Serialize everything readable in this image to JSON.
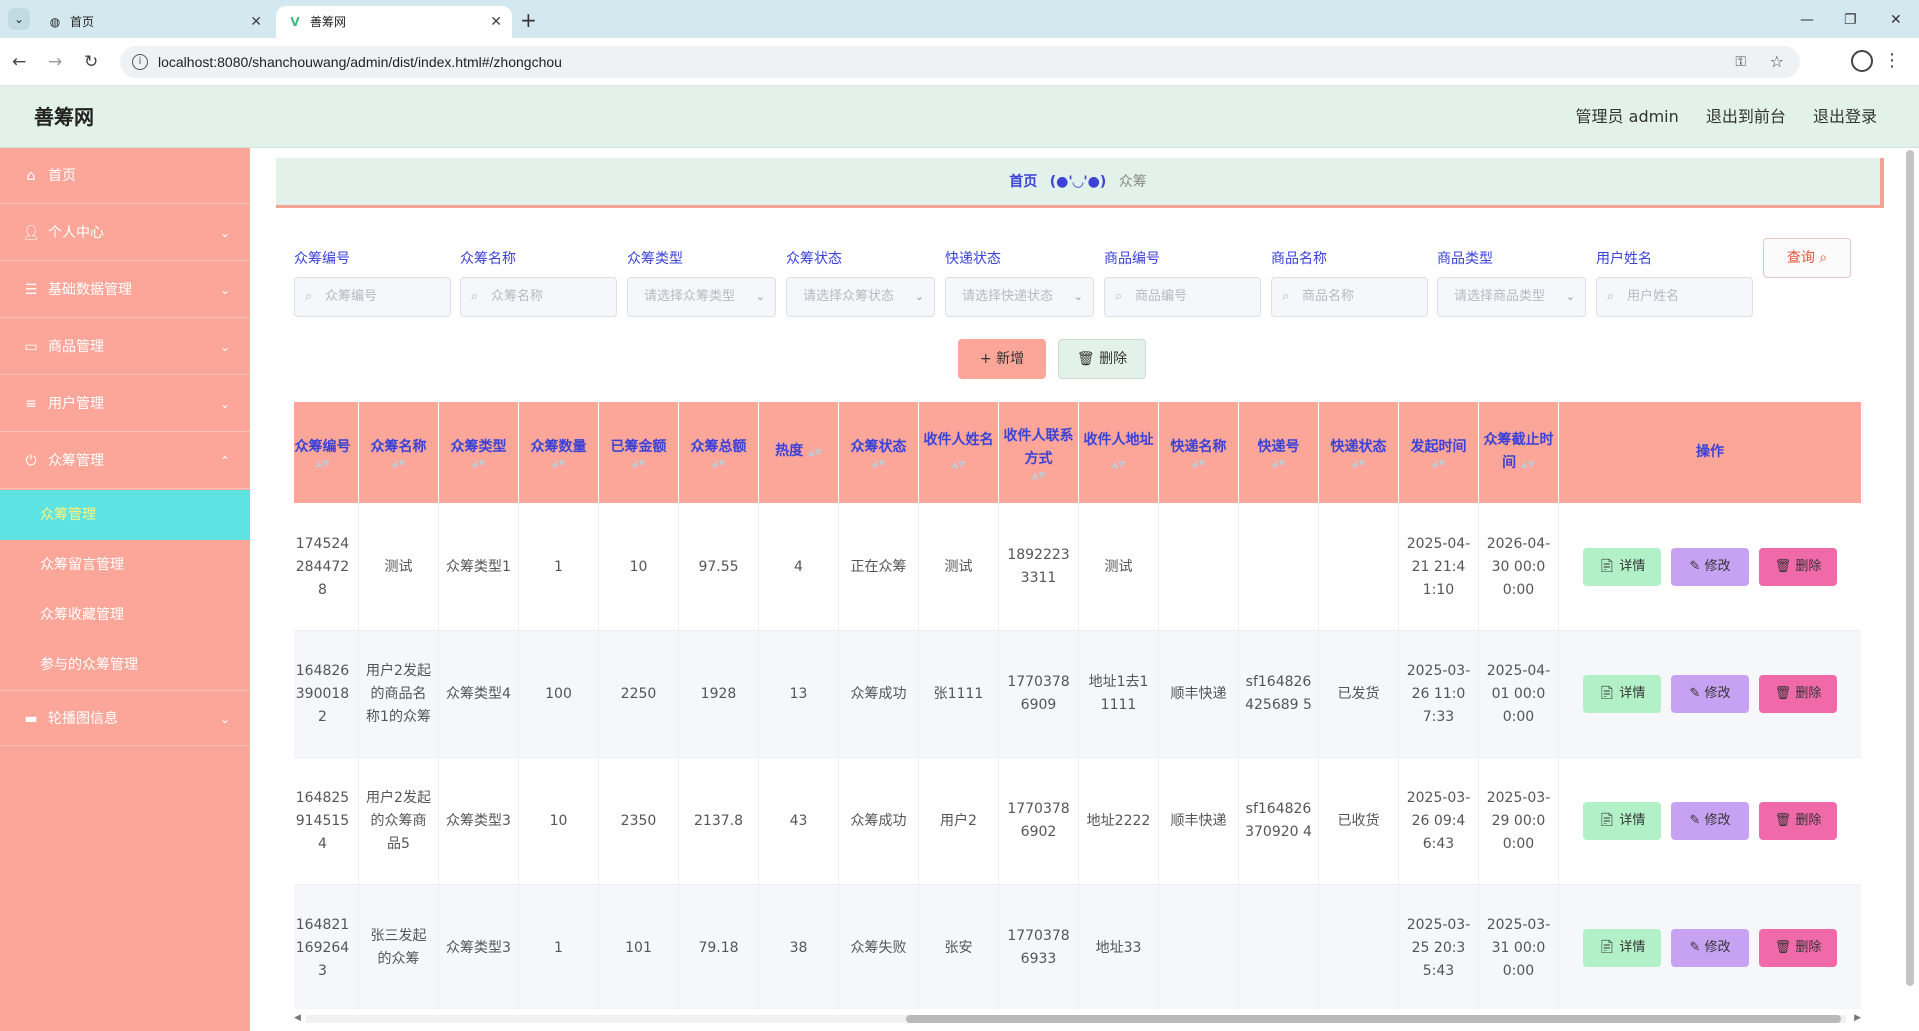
{
  "browser": {
    "tabs": [
      {
        "title": "首页",
        "active": false
      },
      {
        "title": "善筹网",
        "active": true
      }
    ],
    "url": "localhost:8080/shanchouwang/admin/dist/index.html#/zhongchou"
  },
  "header": {
    "brand": "善筹网",
    "admin": "管理员 admin",
    "to_front": "退出到前台",
    "logout": "退出登录"
  },
  "sidebar": {
    "items": [
      {
        "label": "首页",
        "icon": "home-icon"
      },
      {
        "label": "个人中心",
        "icon": "user-icon"
      },
      {
        "label": "基础数据管理",
        "icon": "sliders-icon"
      },
      {
        "label": "商品管理",
        "icon": "card-icon"
      },
      {
        "label": "用户管理",
        "icon": "list-icon"
      },
      {
        "label": "众筹管理",
        "icon": "power-icon"
      },
      {
        "label": "轮播图信息",
        "icon": "monitor-icon"
      }
    ],
    "sub_items": [
      {
        "label": "众筹管理",
        "active": true
      },
      {
        "label": "众筹留言管理",
        "active": false
      },
      {
        "label": "众筹收藏管理",
        "active": false
      },
      {
        "label": "参与的众筹管理",
        "active": false
      }
    ]
  },
  "breadcrumb": {
    "home": "首页",
    "separator": "(●'◡'●)",
    "current": "众筹"
  },
  "filters": [
    {
      "label": "众筹编号",
      "placeholder": "众筹编号",
      "kind": "input"
    },
    {
      "label": "众筹名称",
      "placeholder": "众筹名称",
      "kind": "input"
    },
    {
      "label": "众筹类型",
      "placeholder": "请选择众筹类型",
      "kind": "select"
    },
    {
      "label": "众筹状态",
      "placeholder": "请选择众筹状态",
      "kind": "select"
    },
    {
      "label": "快递状态",
      "placeholder": "请选择快递状态",
      "kind": "select"
    },
    {
      "label": "商品编号",
      "placeholder": "商品编号",
      "kind": "input"
    },
    {
      "label": "商品名称",
      "placeholder": "商品名称",
      "kind": "input"
    },
    {
      "label": "商品类型",
      "placeholder": "请选择商品类型",
      "kind": "select"
    },
    {
      "label": "用户姓名",
      "placeholder": "用户姓名",
      "kind": "input"
    }
  ],
  "actions": {
    "query": "查询",
    "add": "新增",
    "delete": "删除"
  },
  "table": {
    "columns": [
      "众筹编号",
      "众筹名称",
      "众筹类型",
      "众筹数量",
      "已筹金额",
      "众筹总额",
      "热度",
      "众筹状态",
      "收件人姓名",
      "收件人联系方式",
      "收件人地址",
      "快递名称",
      "快递号",
      "快递状态",
      "发起时间",
      "众筹截止时间",
      "操作"
    ],
    "rows": [
      [
        "1745242844728",
        "测试",
        "众筹类型1",
        "1",
        "10",
        "97.55",
        "4",
        "正在众筹",
        "测试",
        "18922233311",
        "测试",
        "",
        "",
        "",
        "2025-04-21 21:41:10",
        "2026-04-30 00:00:00"
      ],
      [
        "1648263900182",
        "用户2发起的商品名称1的众筹",
        "众筹类型4",
        "100",
        "2250",
        "1928",
        "13",
        "众筹成功",
        "张1111",
        "17703786909",
        "地址1去11111",
        "顺丰快递",
        "sf164826425689 5",
        "已发货",
        "2025-03-26 11:07:33",
        "2025-04-01 00:00:00"
      ],
      [
        "1648259145154",
        "用户2发起的众筹商品5",
        "众筹类型3",
        "10",
        "2350",
        "2137.8",
        "43",
        "众筹成功",
        "用户2",
        "17703786902",
        "地址2222",
        "顺丰快递",
        "sf164826370920 4",
        "已收货",
        "2025-03-26 09:46:43",
        "2025-03-29 00:00:00"
      ],
      [
        "1648211692643",
        "张三发起的众筹",
        "众筹类型3",
        "1",
        "101",
        "79.18",
        "38",
        "众筹失败",
        "张安",
        "17703786933",
        "地址33",
        "",
        "",
        "",
        "2025-03-25 20:35:43",
        "2025-03-31 00:00:00"
      ]
    ],
    "row_buttons": {
      "detail": "详情",
      "edit": "修改",
      "delete": "删除"
    }
  }
}
